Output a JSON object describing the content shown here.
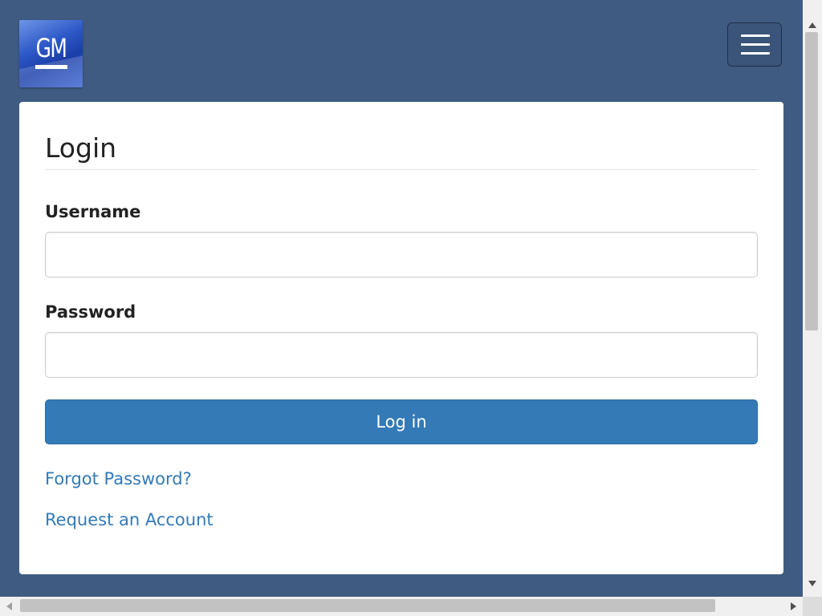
{
  "header": {
    "logo_text": "GM",
    "menu_icon": "hamburger-icon"
  },
  "login": {
    "title": "Login",
    "username_label": "Username",
    "username_value": "",
    "password_label": "Password",
    "password_value": "",
    "submit_label": "Log in",
    "forgot_password_link": "Forgot Password?",
    "request_account_link": "Request an Account"
  },
  "colors": {
    "page_background": "#3f5b82",
    "card_background": "#ffffff",
    "primary_button": "#337ab7",
    "link": "#337ab7"
  }
}
